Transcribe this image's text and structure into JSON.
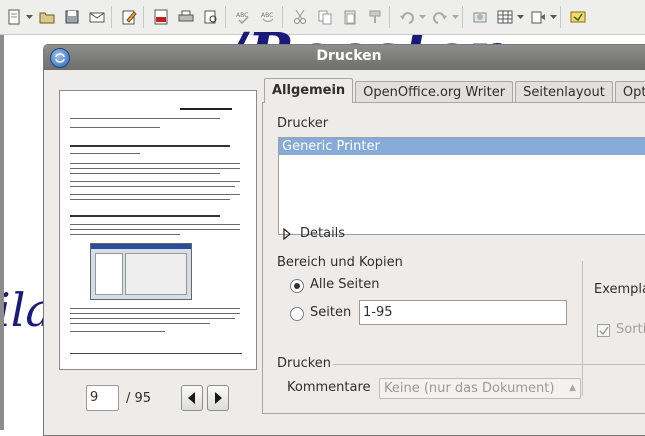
{
  "toolbar": {
    "icons": [
      "new-document-icon",
      "open-icon",
      "save-icon",
      "mail-icon",
      "edit-file-icon",
      "pdf-export-icon",
      "print-icon",
      "print-preview-icon",
      "spellcheck-icon",
      "autocheck-icon",
      "cut-icon",
      "copy-icon",
      "paste-icon",
      "format-paintbrush-icon",
      "undo-icon",
      "redo-icon",
      "hyperlink-icon",
      "table-icon",
      "show-draw-functions-icon",
      "navigator-icon"
    ]
  },
  "background": {
    "title_fragment": "/Recster",
    "side_fragment": "ila"
  },
  "dialog": {
    "title": "Drucken",
    "tabs": [
      "Allgemein",
      "OpenOffice.org Writer",
      "Seitenlayout",
      "Optio"
    ],
    "active_tab": "Allgemein",
    "printer_section_label": "Drucker",
    "printers": [
      "Generic Printer"
    ],
    "details_label": "Details",
    "range_section_label": "Bereich und Kopien",
    "all_pages_label": "Alle Seiten",
    "pages_label": "Seiten",
    "pages_value": "1-95",
    "copies_label": "Exempla",
    "collate_label": "Sorti",
    "print_section_label": "Drucken",
    "comments_label": "Kommentare",
    "comments_value": "Keine (nur das Dokument)",
    "preview": {
      "current_page": "9",
      "total_pages": "/ 95"
    }
  },
  "colors": {
    "selection": "#86abd9",
    "titlebar": "#7e7e7c",
    "doc_title": "#1a1a7a"
  }
}
